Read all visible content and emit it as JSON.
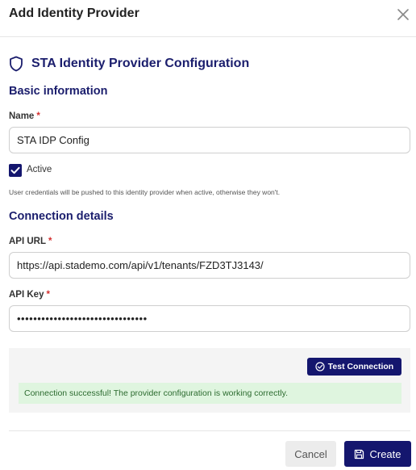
{
  "dialog": {
    "title": "Add Identity Provider",
    "close_icon": "close-icon"
  },
  "config": {
    "heading": "STA Identity Provider Configuration",
    "heading_icon": "shield-icon"
  },
  "basic": {
    "title": "Basic information",
    "name_label": "Name",
    "name_value": "STA IDP Config",
    "active_label": "Active",
    "active_checked": true,
    "hint": "User credentials will be pushed to this identity provider when active, otherwise they won't."
  },
  "connection": {
    "title": "Connection details",
    "api_url_label": "API URL",
    "api_url_value": "https://api.stademo.com/api/v1/tenants/FZD3TJ3143/",
    "api_key_label": "API Key",
    "api_key_value": "••••••••••••••••••••••••••••••••",
    "test_button": "Test Connection",
    "test_icon": "check-circle-icon",
    "success_message": "Connection successful! The provider configuration is working correctly."
  },
  "footer": {
    "cancel_label": "Cancel",
    "create_label": "Create",
    "create_icon": "save-icon"
  },
  "colors": {
    "primary": "#14166e",
    "heading": "#1b1e6d",
    "required": "#d32f2f",
    "success_bg": "#dff5df",
    "success_text": "#2c6b2f"
  }
}
